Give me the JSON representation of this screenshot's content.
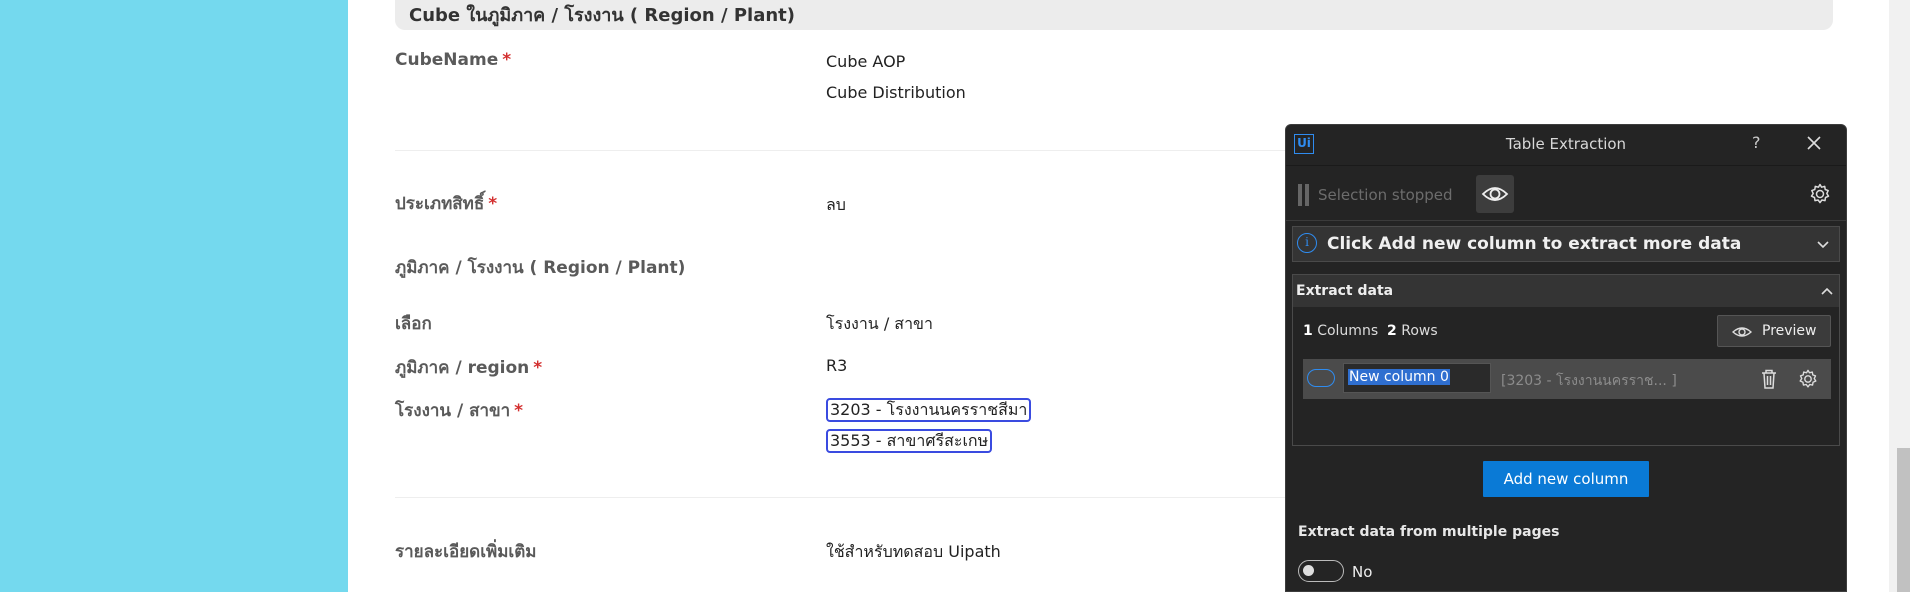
{
  "form": {
    "section_title": "Cube ในภูมิภาค / โรงงาน ( Region / Plant)",
    "cube_name_label": "CubeName",
    "cube_values": [
      "Cube AOP",
      "Cube Distribution"
    ],
    "permission_type_label": "ประเภทสิทธิ์",
    "permission_type_value": "ลบ",
    "region_plant_heading": "ภูมิภาค / โรงงาน ( Region / Plant)",
    "select_label": "เลือก",
    "select_value": "โรงงาน / สาขา",
    "region_label": "ภูมิภาค / region",
    "region_value": "R3",
    "plant_label": "โรงงาน / สาขา",
    "plant_values": [
      "3203 - โรงงานนครราชสีมา",
      "3553 - สาขาศรีสะเกษ"
    ],
    "details_label": "รายละเอียดเพิ่มเติม",
    "details_value": "ใช้สำหรับทดสอบ Uipath",
    "required_mark": "*"
  },
  "panel": {
    "logo_text": "Ui",
    "title": "Table Extraction",
    "help_label": "?",
    "selection_status": "Selection stopped",
    "info_message": "Click Add new column to extract more data",
    "info_icon_text": "i",
    "extract_title": "Extract data",
    "columns_count": "1",
    "columns_label": "Columns",
    "rows_count": "2",
    "rows_label": "Rows",
    "preview_label": "Preview",
    "column": {
      "name": "New column 0",
      "sample": "[3203 - โรงงานนครราช... ]"
    },
    "add_column_label": "Add new column",
    "multi_page_label": "Extract data from multiple pages",
    "multi_page_value": "No"
  },
  "colors": {
    "left_bar": "#74d9ee",
    "accent_blue": "#0a7ad6",
    "highlight_border": "#3a4be0",
    "required": "#d32f2f"
  }
}
